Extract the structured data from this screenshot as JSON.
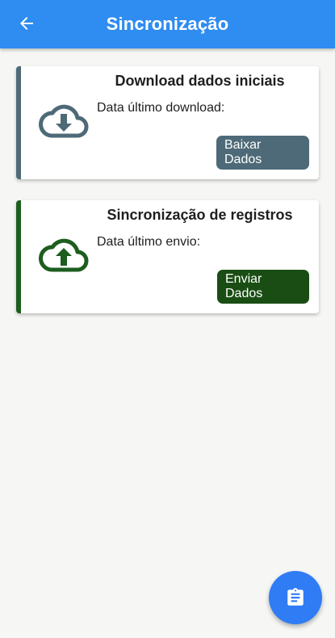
{
  "appbar": {
    "title": "Sincronização",
    "back_icon": "arrow-back-icon",
    "color": "#2f8cf0"
  },
  "cards": [
    {
      "title": "Download dados iniciais",
      "subtitle": "Data último download:",
      "button_label": "Baixar Dados",
      "icon": "cloud-download-icon",
      "accent_color": "#4e6a78"
    },
    {
      "title": "Sincronização de registros",
      "subtitle": "Data último envio:",
      "button_label": "Enviar Dados",
      "icon": "cloud-upload-icon",
      "accent_color": "#1d5e1f"
    }
  ],
  "fab": {
    "icon": "clipboard-icon",
    "color": "#2f7cf5"
  }
}
